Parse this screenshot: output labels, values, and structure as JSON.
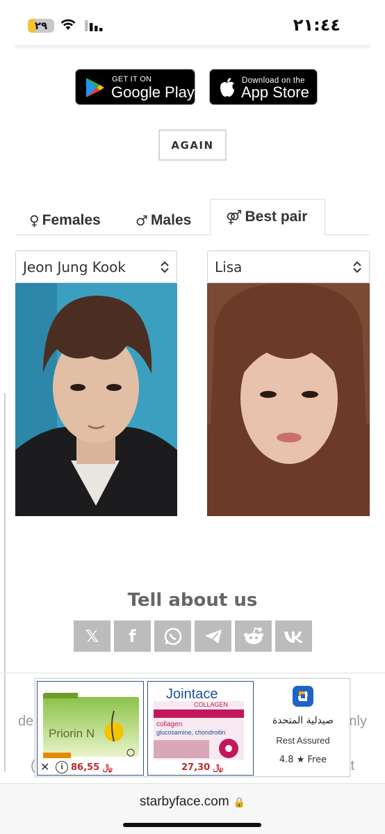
{
  "status_bar": {
    "battery": "٢٩",
    "battery_level": 0.29,
    "time": "٢١:٤٤",
    "icons": [
      "wifi-icon",
      "cellular-signal-icon"
    ]
  },
  "store_badges": {
    "google": {
      "small": "GET IT ON",
      "big": "Google Play"
    },
    "apple": {
      "small": "Download on the",
      "big": "App Store"
    }
  },
  "again_label": "AGAIN",
  "tabs": [
    {
      "symbol": "♀",
      "label": "Females"
    },
    {
      "symbol": "♂",
      "label": "Males"
    },
    {
      "symbol": "⚤",
      "label": "Best pair",
      "active": true
    }
  ],
  "selects": {
    "left": "Jeon Jung Kook",
    "right": "Lisa"
  },
  "share": {
    "title": "Tell about us",
    "buttons": [
      "𝕏",
      "f",
      "whatsapp-icon",
      "telegram-icon",
      "reddit-icon",
      "vk-icon"
    ]
  },
  "background_text": {
    "left": "de",
    "right": "nly",
    "left2": "(",
    "right2": "t"
  },
  "ad": {
    "card1": {
      "product": "Priorin N",
      "price": "86,55 ﷼"
    },
    "card2": {
      "product": "Jointace collagen",
      "price": "27,30 ﷼"
    },
    "app_name": "صيدلية المتحدة",
    "app_desc": "Rest Assured",
    "app_rating": "4.8 ★ Free",
    "close": "✕"
  },
  "browser": {
    "url": "starbyface.com"
  },
  "colors": {
    "price": "#c0282e",
    "share_bg": "#bcbcbc",
    "ad_border": "#2c4f8f"
  }
}
